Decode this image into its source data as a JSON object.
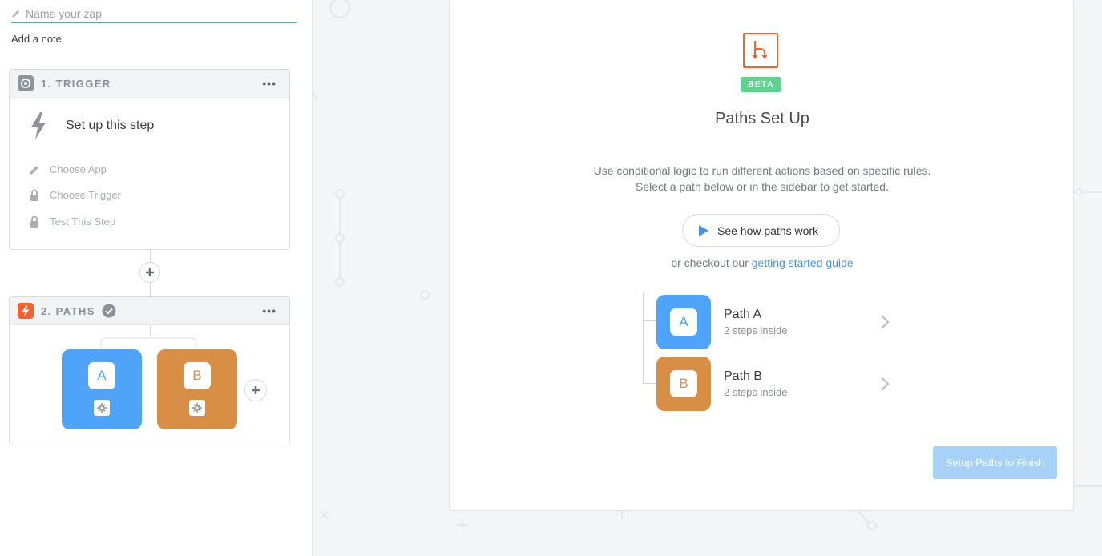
{
  "sidebar": {
    "zap_name": {
      "placeholder": "Name your zap",
      "value": ""
    },
    "add_note": "Add a note",
    "trigger_card": {
      "header": "1. TRIGGER",
      "menu": "•••",
      "setup_title": "Set up this step",
      "steps": [
        {
          "label": "Choose App",
          "icon": "pencil-icon"
        },
        {
          "label": "Choose Trigger",
          "icon": "lock-icon"
        },
        {
          "label": "Test This Step",
          "icon": "lock-icon"
        }
      ]
    },
    "paths_card": {
      "header": "2. PATHS",
      "menu": "•••",
      "tiles": [
        {
          "letter": "A",
          "color": "#4fa4f9",
          "icon": "gear-icon"
        },
        {
          "letter": "B",
          "color": "#d98e45",
          "icon": "gear-icon"
        }
      ]
    }
  },
  "panel": {
    "beta": "BETA",
    "title": "Paths Set Up",
    "description_line1": "Use conditional logic to run different actions based on specific rules.",
    "description_line2": "Select a path below or in the sidebar to get started.",
    "video_button": "See how paths work",
    "checkout_prefix": "or checkout our ",
    "checkout_link": "getting started guide",
    "paths": [
      {
        "letter": "A",
        "name": "Path A",
        "steps": "2 steps inside",
        "color": "#4fa4f9"
      },
      {
        "letter": "B",
        "name": "Path B",
        "steps": "2 steps inside",
        "color": "#d98e45"
      }
    ],
    "finish_button": "Setup Paths to Finish"
  },
  "colors": {
    "accent_blue": "#4a90e2",
    "paths_orange": "#f2622e",
    "beta_green": "#62d18e",
    "finish_disabled": "#a8d1f7"
  }
}
